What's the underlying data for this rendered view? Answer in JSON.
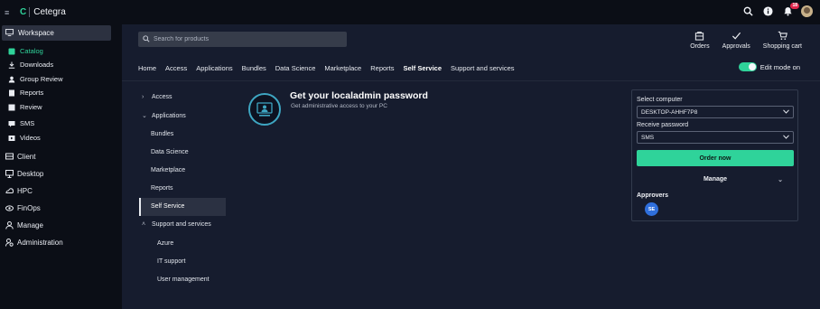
{
  "app": {
    "title": "Cetegra"
  },
  "top_bar": {
    "notification_count": "18"
  },
  "sidebar": {
    "workspace": "Workspace",
    "items": [
      {
        "label": "Catalog",
        "icon": "tag-icon"
      },
      {
        "label": "Downloads",
        "icon": "download-icon"
      },
      {
        "label": "Group Review",
        "icon": "user-group-icon"
      },
      {
        "label": "Reports",
        "icon": "report-icon"
      },
      {
        "label": "Review",
        "icon": "review-icon"
      },
      {
        "label": "SMS",
        "icon": "sms-icon"
      },
      {
        "label": "Videos",
        "icon": "video-icon"
      }
    ],
    "sections": [
      {
        "label": "Client",
        "icon": "client-icon"
      },
      {
        "label": "Desktop",
        "icon": "desktop-icon"
      },
      {
        "label": "HPC",
        "icon": "hpc-icon"
      },
      {
        "label": "FinOps",
        "icon": "finops-icon"
      },
      {
        "label": "Manage",
        "icon": "manage-icon"
      },
      {
        "label": "Administration",
        "icon": "administration-icon"
      }
    ]
  },
  "search": {
    "placeholder": "Search for products"
  },
  "actions": {
    "orders": "Orders",
    "approvals": "Approvals",
    "cart": "Shopping cart"
  },
  "nav": {
    "tabs": [
      "Home",
      "Access",
      "Applications",
      "Bundles",
      "Data Science",
      "Marketplace",
      "Reports",
      "Self Service",
      "Support and services"
    ],
    "active": "Self Service",
    "edit_mode": "Edit mode on"
  },
  "tree": {
    "access": "Access",
    "applications": "Applications",
    "bundles": "Bundles",
    "data_science": "Data Science",
    "marketplace": "Marketplace",
    "reports": "Reports",
    "self_service": "Self Service",
    "support": "Support and services",
    "azure": "Azure",
    "it_support": "IT support",
    "user_management": "User management"
  },
  "product": {
    "title": "Get your localadmin password",
    "subtitle": "Get administrative access to your PC"
  },
  "order": {
    "computer_label": "Select computer",
    "computer_value": "DESKTOP-AHHF7P8",
    "password_label": "Receive password",
    "password_value": "SMS",
    "order_button": "Order now",
    "manage_button": "Manage",
    "approvers_label": "Approvers",
    "approver_initials": "SE"
  },
  "colors": {
    "accent": "#2fd39a",
    "background": "#161c2e",
    "sidebar": "#0b0e16",
    "approver": "#2f6fdc"
  }
}
